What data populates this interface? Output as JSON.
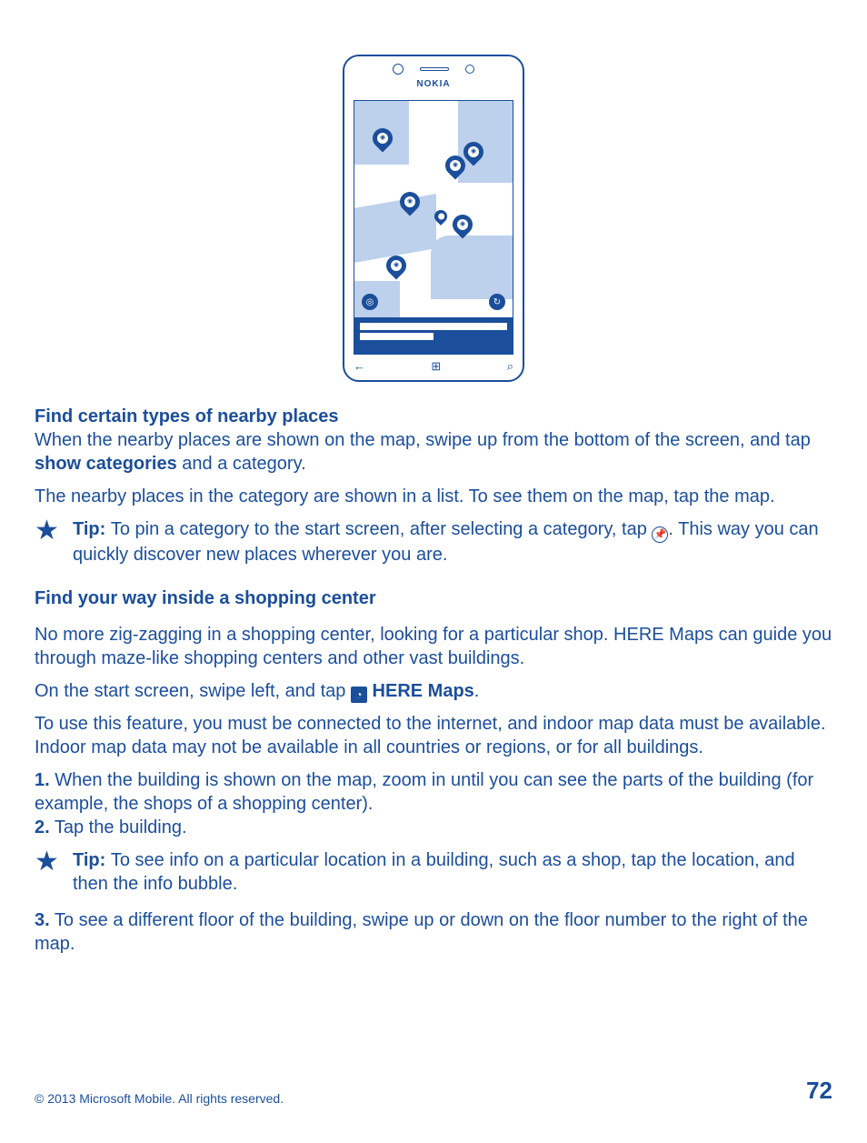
{
  "section1": {
    "heading": "Find certain types of nearby places",
    "p1_a": "When the nearby places are shown on the map, swipe up from the bottom of the screen, and tap ",
    "p1_bold": "show categories",
    "p1_b": " and a category.",
    "p2": "The nearby places in the category are shown in a list. To see them on the map, tap the map.",
    "tip_label": "Tip: ",
    "tip_a": "To pin a category to the start screen, after selecting a category, tap ",
    "tip_b": ". This way you can quickly discover new places wherever you are."
  },
  "section2": {
    "heading": "Find your way inside a shopping center",
    "p1": "No more zig-zagging in a shopping center, looking for a particular shop. HERE Maps can guide you through maze-like shopping centers and other vast buildings.",
    "p2_a": "On the start screen, swipe left, and tap ",
    "p2_app": "HERE Maps",
    "p2_b": ".",
    "p3": "To use this feature, you must be connected to the internet, and indoor map data must be available. Indoor map data may not be available in all countries or regions, or for all buildings.",
    "step1_num": "1.",
    "step1": " When the building is shown on the map, zoom in until you can see the parts of the building (for example, the shops of a shopping center).",
    "step2_num": "2.",
    "step2": " Tap the building.",
    "tip_label": "Tip: ",
    "tip": "To see info on a particular location in a building, such as a shop, tap the location, and then the info bubble.",
    "step3_num": "3.",
    "step3": " To see a different floor of the building, swipe up or down on the floor number to the right of the map."
  },
  "footer": {
    "copyright": "© 2013 Microsoft Mobile. All rights reserved.",
    "page": "72"
  },
  "phone": {
    "brand": "NOKIA"
  }
}
